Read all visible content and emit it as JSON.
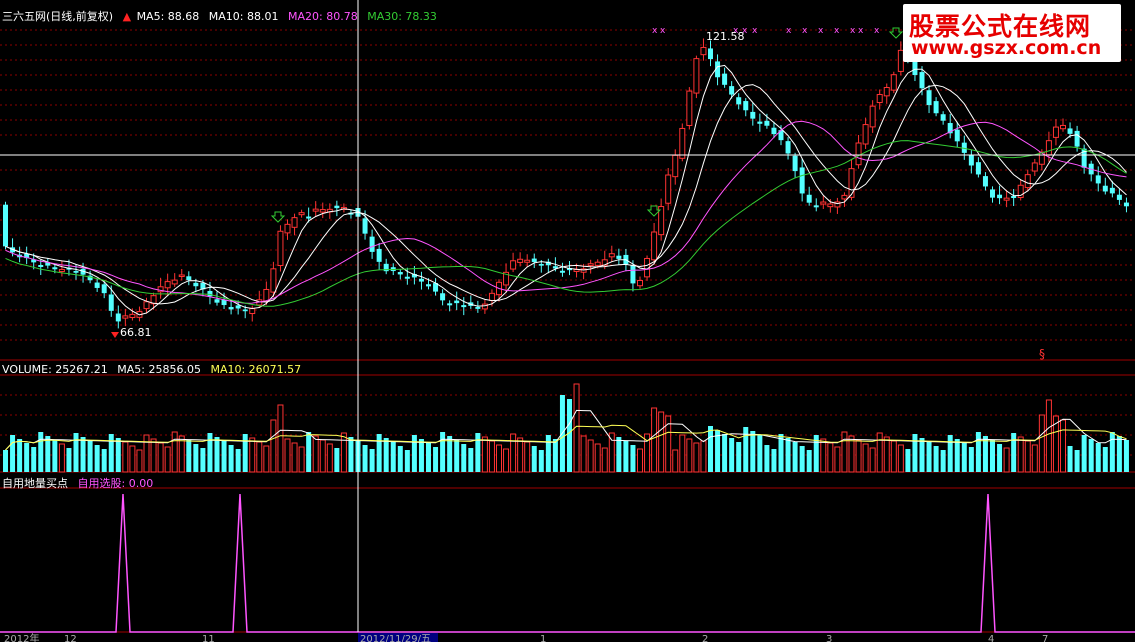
{
  "main_panel": {
    "stock_title": "三六五网(日线,前复权)",
    "indicators": [
      {
        "label": "MA5: 88.68",
        "color": "#ffffff"
      },
      {
        "label": "MA10: 88.01",
        "color": "#ffffff"
      },
      {
        "label": "MA20: 80.78",
        "color": "#ff55ff"
      },
      {
        "label": "MA30: 78.33",
        "color": "#33cc33"
      }
    ],
    "high_label": "121.58",
    "low_label": "66.81",
    "signal_label": "§"
  },
  "volume_panel": {
    "indicators": [
      {
        "label": "VOLUME: 25267.21",
        "color": "#ffffff"
      },
      {
        "label": "MA5: 25856.05",
        "color": "#ffffff"
      },
      {
        "label": "MA10: 26071.57",
        "color": "#ffff55"
      }
    ]
  },
  "signal_panel": {
    "indicators": [
      {
        "label": "自用地量买点",
        "color": "#ffffff"
      },
      {
        "label": "自用选股: 0.00",
        "color": "#ff55ff"
      }
    ]
  },
  "date_axis": {
    "labels": [
      "2012年",
      "12",
      "11",
      "2012/11/29/五",
      "1",
      "2",
      "3",
      "4",
      "7"
    ]
  },
  "watermark": {
    "line1": "股票公式在线网",
    "line2": "www.gszx.com.cn"
  },
  "colors": {
    "up": "#ff3333",
    "down": "#54ffff",
    "ma5": "#ffffff",
    "ma10": "#ffffff",
    "ma20": "#ff55ff",
    "ma30": "#33cc33",
    "grid": "#8b0000"
  }
}
